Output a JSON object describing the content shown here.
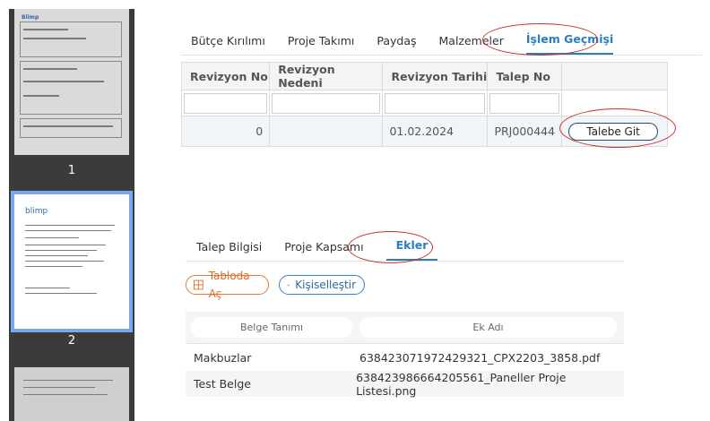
{
  "sidebar": {
    "pages": [
      {
        "number": "1",
        "logo": "Blimp"
      },
      {
        "number": "2",
        "logo": "blimp"
      },
      {
        "number": ""
      }
    ]
  },
  "top_tabs": [
    {
      "label": "Bütçe Kırılımı",
      "active": false
    },
    {
      "label": "Proje Takımı",
      "active": false
    },
    {
      "label": "Paydaş",
      "active": false
    },
    {
      "label": "Malzemeler",
      "active": false
    },
    {
      "label": "İşlem Geçmişi",
      "active": true
    }
  ],
  "revision_table": {
    "headers": [
      "Revizyon No",
      "Revizyon Nedeni",
      "Revizyon Tarihi",
      "Talep No"
    ],
    "rows": [
      {
        "revizyon_no": "0",
        "revizyon_nedeni": "",
        "revizyon_tarihi": "01.02.2024",
        "talep_no": "PRJ000444",
        "action_label": "Talebe Git"
      }
    ]
  },
  "bottom_tabs": [
    {
      "label": "Talep Bilgisi",
      "active": false
    },
    {
      "label": "Proje Kapsamı",
      "active": false
    },
    {
      "label": "Ekler",
      "active": true
    }
  ],
  "actions": {
    "open_table_label": "Tabloda Aç",
    "open_table_icon": "table-icon",
    "customize_label": "Kişiselleştir",
    "customize_icon": "gear-icon"
  },
  "attachments": {
    "headers": [
      "Belge Tanımı",
      "Ek Adı"
    ],
    "rows": [
      {
        "belge": "Makbuzlar",
        "ek": "638423071972429321_CPX2203_3858.pdf"
      },
      {
        "belge": "Test Belge",
        "ek": "638423986664205561_Paneller Proje Listesi.png"
      }
    ]
  },
  "colors": {
    "accent_blue": "#2c7cbf",
    "annotation_red": "#c9302c",
    "orange": "#e06a22",
    "sidebar_bg": "#3b3b3b"
  }
}
